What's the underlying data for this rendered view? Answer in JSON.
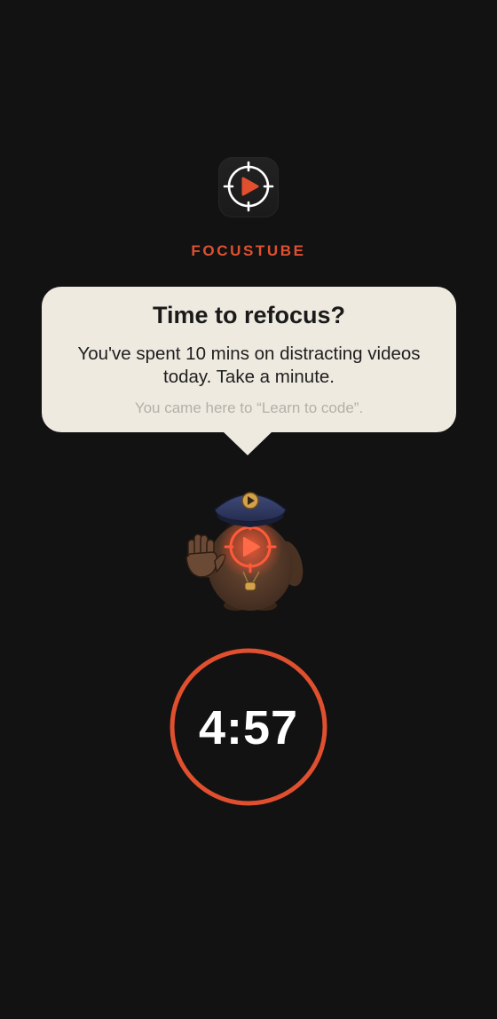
{
  "app": {
    "name": "FOCUSTUBE",
    "accent_color": "#e0502f",
    "icon": "crosshair-play-icon"
  },
  "prompt": {
    "title": "Time to refocus?",
    "message": "You've spent 10 mins on distracting videos today. Take a minute.",
    "intention": "You came here to “Learn to code”."
  },
  "mascot": {
    "icon": "police-mascot-stop-icon"
  },
  "timer": {
    "value": "4:57",
    "ring_color": "#e0502f"
  }
}
